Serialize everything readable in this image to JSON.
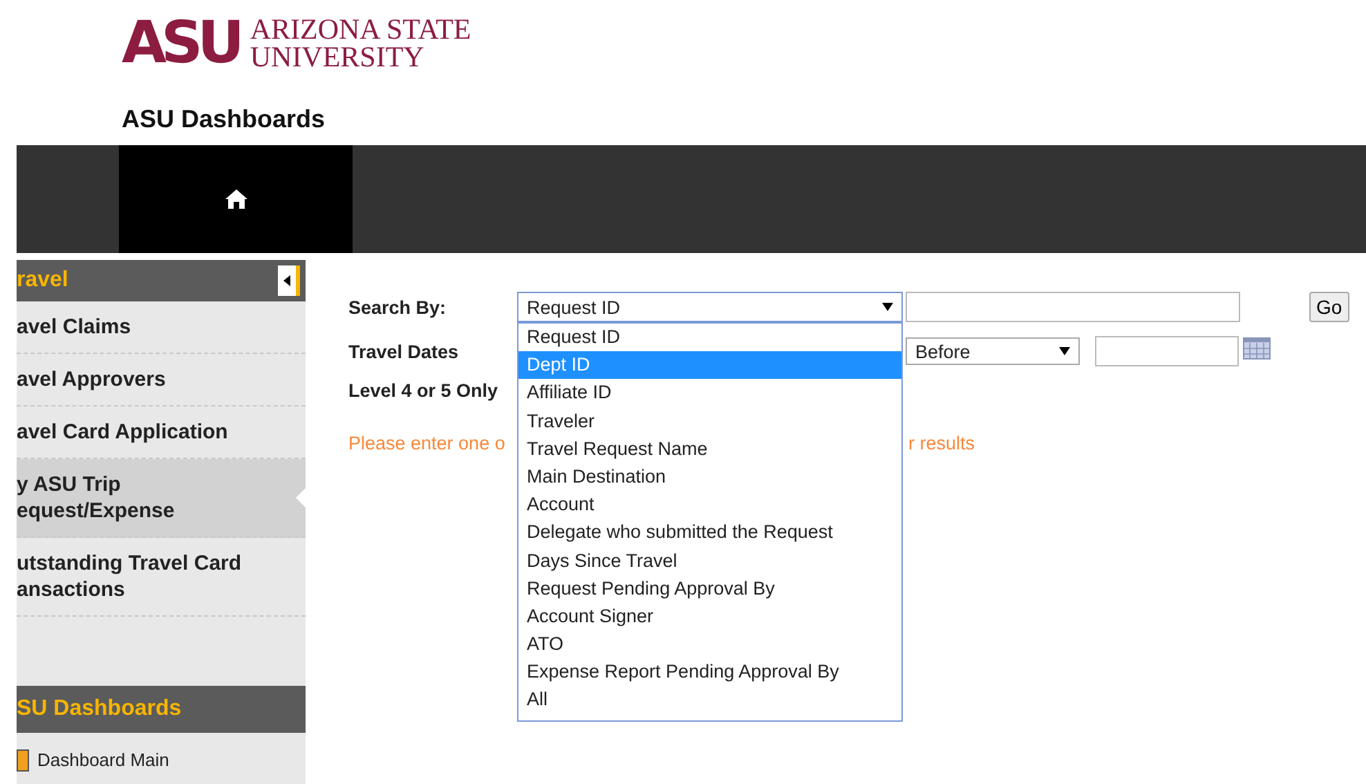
{
  "logo": {
    "mark": "ASU",
    "line_1": "ARIZONA STATE",
    "line_2": "UNIVERSITY"
  },
  "app_title": "ASU Dashboards",
  "sidebar": {
    "sections": [
      {
        "title": "ravel",
        "items": [
          {
            "lines": [
              "avel Claims"
            ],
            "selected": false
          },
          {
            "lines": [
              "avel Approvers"
            ],
            "selected": false
          },
          {
            "lines": [
              "avel Card Application"
            ],
            "selected": false
          },
          {
            "lines": [
              "y ASU Trip",
              "equest/Expense"
            ],
            "selected": true
          },
          {
            "lines": [
              "utstanding Travel Card",
              "ansactions"
            ],
            "selected": false
          }
        ]
      },
      {
        "title": "SU Dashboards",
        "items": [
          {
            "lines": [
              "Dashboard Main"
            ],
            "selected": false,
            "kind": "icon"
          }
        ]
      }
    ]
  },
  "form": {
    "search_by": {
      "label": "Search By:",
      "value": "Request ID",
      "button": "Go"
    },
    "travel_dates": {
      "label": "Travel Dates",
      "relation": "Before"
    },
    "level_filter": {
      "label": "Level 4 or 5 Only"
    },
    "message": [
      "Please enter one o",
      "r results"
    ],
    "dropdown_options": [
      {
        "label": "Request ID",
        "selected": false
      },
      {
        "label": "Dept ID",
        "selected": true
      },
      {
        "label": "Affiliate ID",
        "selected": false
      },
      {
        "label": "Traveler",
        "selected": false
      },
      {
        "label": "Travel Request Name",
        "selected": false
      },
      {
        "label": "Main Destination",
        "selected": false
      },
      {
        "label": "Account",
        "selected": false
      },
      {
        "label": "Delegate who submitted the Request",
        "selected": false
      },
      {
        "label": "Days Since Travel",
        "selected": false
      },
      {
        "label": "Request Pending Approval By",
        "selected": false
      },
      {
        "label": "Account Signer",
        "selected": false
      },
      {
        "label": "ATO",
        "selected": false
      },
      {
        "label": "Expense Report Pending Approval By",
        "selected": false
      },
      {
        "label": "All",
        "selected": false
      }
    ]
  }
}
